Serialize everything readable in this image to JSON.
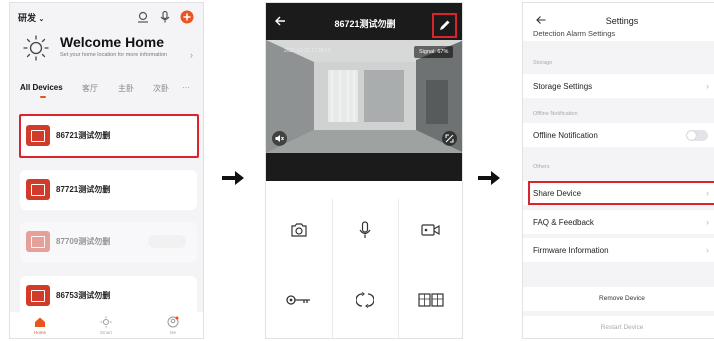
{
  "home_screen": {
    "home_name": "研发",
    "welcome_title": "Welcome Home",
    "welcome_subtitle": "Set your home location for more information",
    "tabs": [
      {
        "label": "All Devices",
        "active": true
      },
      {
        "label": "客厅",
        "active": false
      },
      {
        "label": "主卧",
        "active": false
      },
      {
        "label": "次卧",
        "active": false
      },
      {
        "label": "···",
        "active": false
      }
    ],
    "devices": [
      {
        "name": "86721测试勿删",
        "online": true,
        "highlighted": true
      },
      {
        "name": "87721测试勿删",
        "online": true,
        "highlighted": false
      },
      {
        "name": "87709测试勿删",
        "online": false,
        "highlighted": false
      },
      {
        "name": "86753测试勿删",
        "online": true,
        "highlighted": false
      }
    ],
    "bottom_nav": [
      {
        "label": "Home",
        "icon": "home-icon",
        "active": true
      },
      {
        "label": "Smart",
        "icon": "smart-icon",
        "active": false
      },
      {
        "label": "Me",
        "icon": "profile-icon",
        "active": false
      }
    ]
  },
  "camera_screen": {
    "title": "86721测试勿删",
    "timestamp": "2025-02-12 17:38:15",
    "signal": "Signal: 67%",
    "controls": [
      {
        "icon": "screenshot-camera-icon"
      },
      {
        "icon": "microphone-icon"
      },
      {
        "icon": "record-video-icon"
      },
      {
        "icon": "key-unlock-icon"
      },
      {
        "icon": "rotate-icon"
      },
      {
        "icon": "gallery-icon"
      }
    ]
  },
  "settings_screen": {
    "title": "Settings",
    "cut_off_row": "Detection Alarm Settings",
    "sections": [
      {
        "header": "Storage",
        "rows": [
          {
            "label": "Storage Settings",
            "type": "link"
          }
        ]
      },
      {
        "header": "Offline Notification",
        "rows": [
          {
            "label": "Offline Notification",
            "type": "toggle",
            "on": false
          }
        ]
      },
      {
        "header": "Others",
        "rows": [
          {
            "label": "Share Device",
            "type": "link",
            "highlighted": true
          },
          {
            "label": "FAQ & Feedback",
            "type": "link"
          },
          {
            "label": "Firmware Information",
            "type": "link"
          }
        ]
      }
    ],
    "actions": {
      "remove": "Remove Device",
      "restart": "Restart Device"
    }
  },
  "colors": {
    "accent": "#e8551e",
    "highlight_border": "#d9232d",
    "device_thumb": "#d23b2a",
    "camera_header": "#1b1b1b"
  }
}
